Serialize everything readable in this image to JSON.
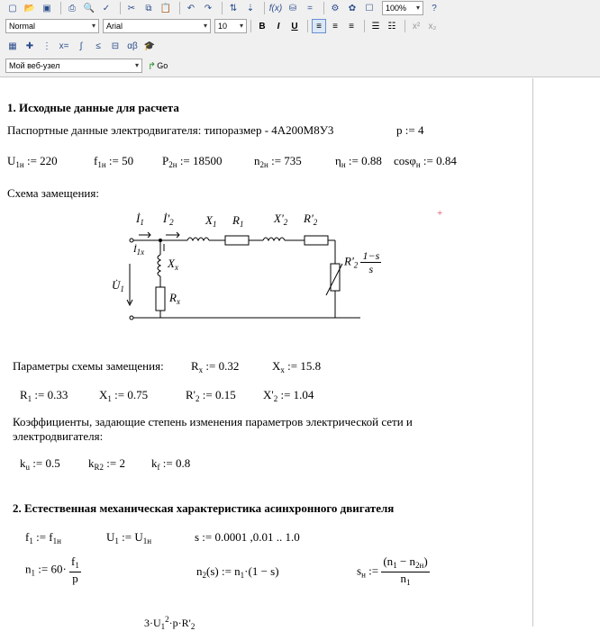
{
  "toolbar": {
    "style_combo": "Normal",
    "font_combo": "Arial",
    "size_combo": "10",
    "zoom_combo": "100%",
    "bold": "B",
    "italic": "I",
    "underline": "U",
    "address_combo": "Мой веб-узел",
    "go_label": "Go"
  },
  "section1": {
    "heading": "1. Исходные данные для расчета",
    "passport_text": "Паспортные данные электродвигателя: типоразмер - 4А200М8У3",
    "p_def": "p := 4",
    "u1n": "U",
    "u1n_sub": "1н",
    "u1n_val": " := 220",
    "f1n": "f",
    "f1n_sub": "1н",
    "f1n_val": " := 50",
    "p2n": "P",
    "p2n_sub": "2н",
    "p2n_val": " := 18500",
    "n2n": "n",
    "n2n_sub": "2н",
    "n2n_val": " := 735",
    "eta": "η",
    "eta_sub": "н",
    "eta_val": " := 0.88",
    "cos": "cosφ",
    "cos_sub": "н",
    "cos_val": " := 0.84",
    "scheme_label": "Схема замещения:",
    "params_label": "Параметры схемы замещения:",
    "rx": "R",
    "rx_sub": "x",
    "rx_val": " := 0.32",
    "xx": "X",
    "xx_sub": "x",
    "xx_val": " := 15.8",
    "r1": "R",
    "r1_sub": "1",
    "r1_val": " := 0.33",
    "x1": "X",
    "x1_sub": "1",
    "x1_val": " := 0.75",
    "r2p": "R'",
    "r2p_sub": "2",
    "r2p_val": " := 0.15",
    "x2p": "X'",
    "x2p_sub": "2",
    "x2p_val": " := 1.04",
    "coef_text_1": "Коэффициенты, задающие степень изменения параметров электрической сети и",
    "coef_text_2": "электродвигателя:",
    "ku": "k",
    "ku_sub": "u",
    "ku_val": " := 0.5",
    "kr2": "k",
    "kr2_sub": "R2",
    "kr2_val": " := 2",
    "kf": "k",
    "kf_sub": "f",
    "kf_val": " := 0.8"
  },
  "circuit": {
    "i1": "İ",
    "i1_sub": "1",
    "i2": "İ'",
    "i2_sub": "2",
    "x1": "X",
    "x1_sub": "1",
    "r1": "R",
    "r1_sub": "1",
    "x2": "X'",
    "x2_sub": "2",
    "r2": "R'",
    "r2_sub": "2",
    "i1x": "İ",
    "i1x_sub": "1x",
    "xx": "X",
    "xx_sub": "x",
    "u1": "U̇",
    "u1_sub": "1",
    "rx": "R",
    "rx_sub": "x",
    "r2load": "R'",
    "r2load_sub": "2",
    "frac_num": "1−s",
    "frac_den": "s"
  },
  "section2": {
    "heading": "2. Естественная механическая характеристика асинхронного двигателя",
    "f1_lhs": "f",
    "f1_lhs_sub": "1",
    "f1_rhs": " := f",
    "f1_rhs_sub": "1н",
    "u1_lhs": "U",
    "u1_lhs_sub": "1",
    "u1_rhs": " := U",
    "u1_rhs_sub": "1н",
    "s_range": "s := 0.0001 ,0.01 .. 1.0",
    "n1_lhs": "n",
    "n1_lhs_sub": "1",
    "n1_mid": " := 60·",
    "n1_num": "f",
    "n1_num_sub": "1",
    "n1_den": "p",
    "n2_expr": "n",
    "n2_sub": "2",
    "n2_rest": "(s) := n",
    "n2_rest_sub": "1",
    "n2_tail": "·(1 − s)",
    "sn_lhs": "s",
    "sn_lhs_sub": "н",
    "sn_mid": " := ",
    "sn_num": "(n",
    "sn_num_sub": "1",
    "sn_num_mid": " − n",
    "sn_num_sub2": "2н",
    "sn_num_end": ")",
    "sn_den": "n",
    "sn_den_sub": "1",
    "partial_formula": "3·U",
    "partial_sub": "1",
    "partial_sup": "2",
    "partial_rest": "·p·R'",
    "partial_rest_sub": "2"
  }
}
